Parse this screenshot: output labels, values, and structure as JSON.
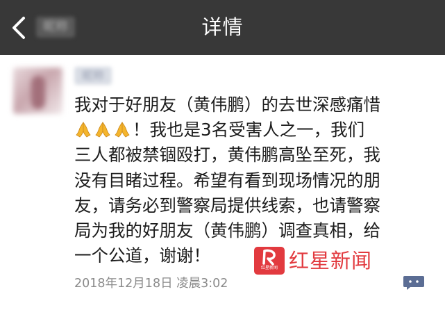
{
  "nav": {
    "title": "详情",
    "back_icon": "chevron-left-icon",
    "blurred_name": "昵称"
  },
  "post": {
    "author_name": "昵称",
    "lines": [
      "我对于好朋友（黄伟鹏）的去世深感痛惜",
      "！我也是3名受害人之一，我们",
      "三人都被禁锢殴打，黄伟鹏高坠至死，我",
      "没有目睹过程。希望有看到现场情况的朋",
      "友，请务必到警察局提供线索，也请警察",
      "局为我的好朋友（黄伟鹏）调查真相，给",
      "一个公道，谢谢！"
    ],
    "emoji_icon": "folded-hands-icon",
    "emoji_count": 3,
    "timestamp": "2018年12月18日 凌晨3:02",
    "comment_icon": "comment-bubble-icon"
  },
  "watermark": {
    "text": "红星新闻",
    "logo_text": "红星新闻"
  },
  "colors": {
    "nav_background": "#383838",
    "nav_text": "#ffffff",
    "body_text": "#1c1c1c",
    "timestamp_text": "#8a8a8a",
    "watermark_red": "#e23a3f",
    "comment_blue": "#5b6d94"
  }
}
